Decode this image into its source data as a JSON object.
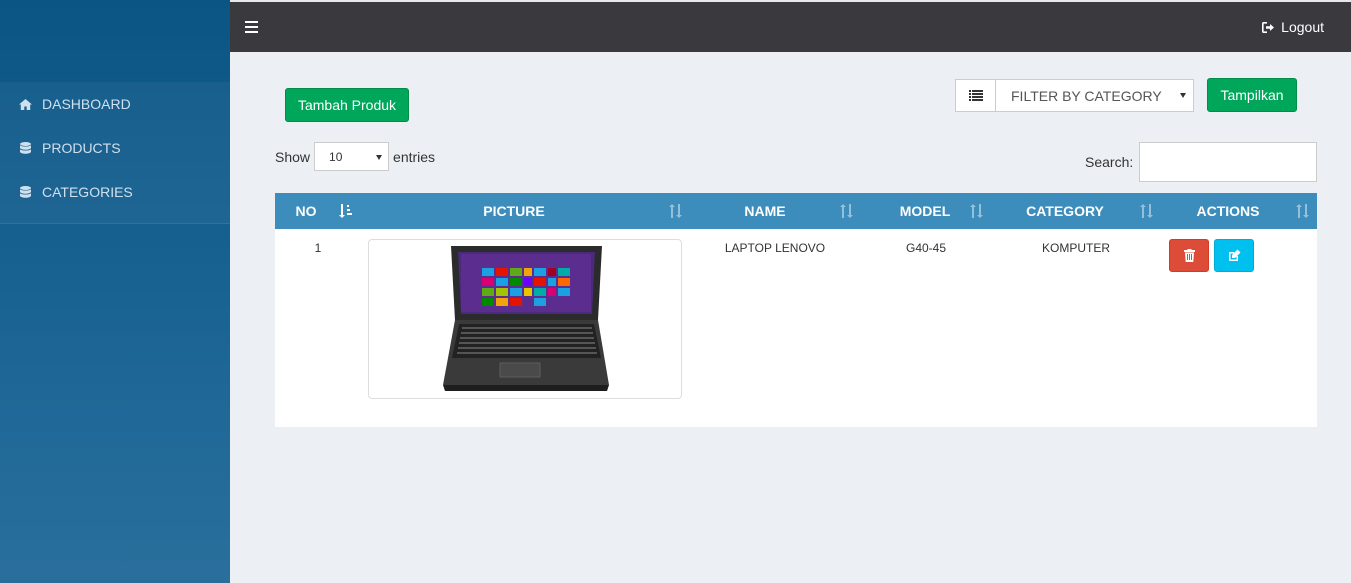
{
  "sidebar": {
    "items": [
      {
        "label": "DASHBOARD",
        "icon": "home-icon"
      },
      {
        "label": "PRODUCTS",
        "icon": "database-icon"
      },
      {
        "label": "CATEGORIES",
        "icon": "database-icon"
      }
    ]
  },
  "topbar": {
    "logout_label": "Logout"
  },
  "toolbar": {
    "add_label": "Tambah Produk",
    "filter_value": "FILTER BY CATEGORY",
    "show_label": "Tampilkan"
  },
  "table_controls": {
    "show_prefix": "Show",
    "entries_value": "10",
    "entries_suffix": "entries",
    "search_label": "Search:",
    "search_value": ""
  },
  "table": {
    "headers": [
      "NO",
      "PICTURE",
      "NAME",
      "MODEL",
      "CATEGORY",
      "ACTIONS"
    ],
    "rows": [
      {
        "no": "1",
        "name": "LAPTOP LENOVO",
        "model": "G40-45",
        "category": "KOMPUTER"
      }
    ]
  },
  "colors": {
    "accent": "#3c8dbc",
    "success": "#00a65a",
    "danger": "#dd4b39",
    "info": "#00c0ef",
    "topbar": "#39393e"
  }
}
